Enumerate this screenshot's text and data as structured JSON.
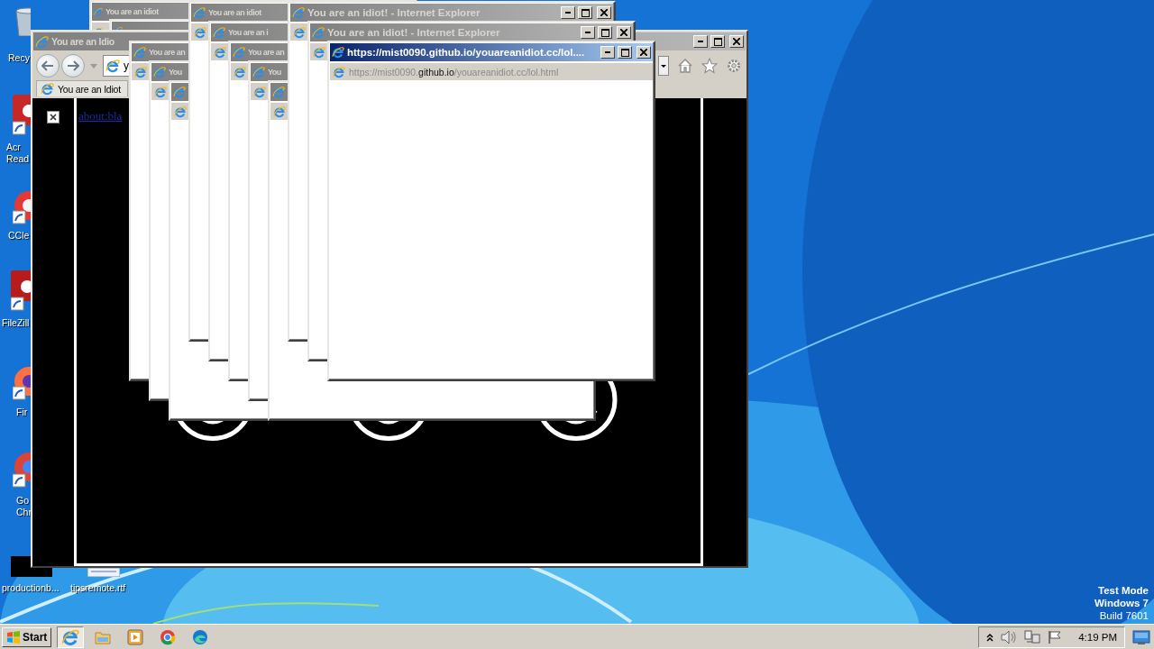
{
  "desktop_icons": [
    {
      "kind": "recycle-bin",
      "lines": [
        "Recy"
      ]
    },
    {
      "kind": "acrobat",
      "lines": [
        "Acr",
        "Read"
      ]
    },
    {
      "kind": "ccleaner",
      "lines": [
        "CCle"
      ]
    },
    {
      "kind": "filezilla",
      "lines": [
        "FileZill"
      ]
    },
    {
      "kind": "firefox",
      "lines": [
        "Fir"
      ]
    },
    {
      "kind": "chrome",
      "lines": [
        "Go",
        "Chr"
      ]
    },
    {
      "kind": "video",
      "lines": [
        "productionb..."
      ]
    },
    {
      "kind": "document",
      "lines": [
        "tipsremote.rtf"
      ]
    }
  ],
  "background_windows": [
    {
      "title": "You are an idiot",
      "active": false
    },
    {
      "active": false
    }
  ],
  "main_window": {
    "title": "You are an Idio",
    "active": false,
    "address": "y",
    "tab": "You are an Idiot",
    "link": "about:bla"
  },
  "popup_windows": [
    {
      "title": "You are an",
      "active": false
    },
    {
      "title": "You",
      "active": false
    },
    {
      "active": false
    },
    {
      "title": "You are an idiot",
      "active": false
    },
    {
      "title": "You are an i",
      "active": false
    },
    {
      "title": "You are an",
      "active": false
    },
    {
      "title": "You",
      "active": false
    },
    {
      "active": false
    },
    {
      "title": "You are an idiot! - Internet Explorer",
      "active": false
    },
    {
      "title": "You are an idiot! - Internet Explorer",
      "active": false
    },
    {
      "title": "https://mist0090.github.io/youareanidiot.cc/lol....",
      "active": true,
      "address": {
        "prefix": "https://mist0090.",
        "domain": "github.io",
        "path": "/youareanidiot.cc/lol.html"
      }
    }
  ],
  "system_notice": [
    "Test Mode",
    "Windows 7",
    "Build 7601"
  ],
  "taskbar": {
    "start": "Start",
    "apps": [
      {
        "kind": "ie",
        "selected": true
      },
      {
        "kind": "explorer",
        "selected": false
      },
      {
        "kind": "media",
        "selected": false
      },
      {
        "kind": "chrome",
        "selected": false
      },
      {
        "kind": "edge",
        "selected": false
      }
    ],
    "clock": "4:19 PM"
  }
}
